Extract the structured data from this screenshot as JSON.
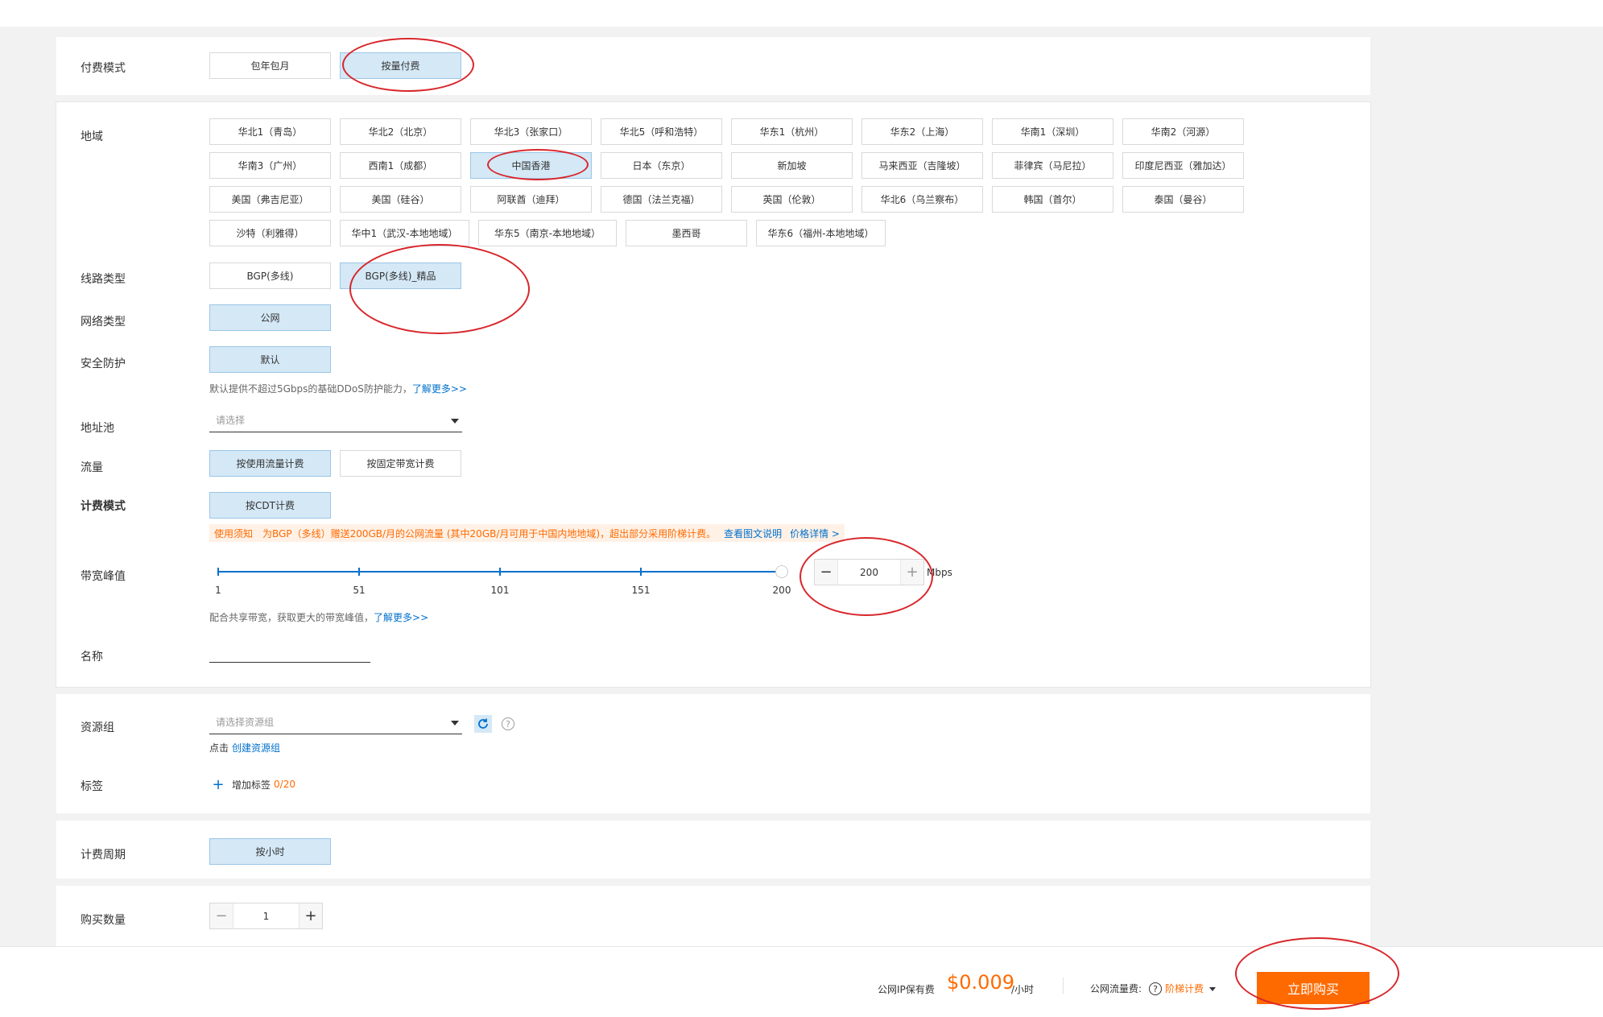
{
  "billing_mode": {
    "label": "付费模式",
    "options": [
      "包年包月",
      "按量付费"
    ],
    "selected": "按量付费"
  },
  "region": {
    "label": "地域",
    "options": [
      "华北1（青岛）",
      "华北2（北京）",
      "华北3（张家口）",
      "华北5（呼和浩特）",
      "华东1（杭州）",
      "华东2（上海）",
      "华南1（深圳）",
      "华南2（河源）",
      "华南3（广州）",
      "西南1（成都）",
      "中国香港",
      "日本（东京）",
      "新加坡",
      "马来西亚（吉隆坡）",
      "菲律宾（马尼拉）",
      "印度尼西亚（雅加达）",
      "美国（弗吉尼亚）",
      "美国（硅谷）",
      "阿联酋（迪拜）",
      "德国（法兰克福）",
      "英国（伦敦）",
      "华北6（乌兰察布）",
      "韩国（首尔）",
      "泰国（曼谷）",
      "沙特（利雅得）",
      "华中1（武汉-本地地域）",
      "华东5（南京-本地地域）",
      "墨西哥",
      "华东6（福州-本地地域）"
    ],
    "selected": "中国香港"
  },
  "line_type": {
    "label": "线路类型",
    "options": [
      "BGP(多线)",
      "BGP(多线)_精品"
    ],
    "selected": "BGP(多线)_精品"
  },
  "network_type": {
    "label": "网络类型",
    "options": [
      "公网"
    ],
    "selected": "公网"
  },
  "security": {
    "label": "安全防护",
    "options": [
      "默认"
    ],
    "selected": "默认",
    "hint": "默认提供不超过5Gbps的基础DDoS防护能力，",
    "hint_link": "了解更多>>"
  },
  "address_pool": {
    "label": "地址池",
    "placeholder": "请选择"
  },
  "traffic": {
    "label": "流量",
    "options": [
      "按使用流量计费",
      "按固定带宽计费"
    ],
    "selected": "按使用流量计费"
  },
  "billing_method": {
    "label": "计费模式",
    "options": [
      "按CDT计费"
    ],
    "selected": "按CDT计费",
    "notice_tag": "使用须知",
    "notice_text": "为BGP（多线）赠送200GB/月的公网流量 (其中20GB/月可用于中国内地地域)，超出部分采用阶梯计费。",
    "notice_link1": "查看图文说明",
    "notice_link2": "价格详情 >"
  },
  "bandwidth": {
    "label": "带宽峰值",
    "ticks": [
      "1",
      "51",
      "101",
      "151",
      "200"
    ],
    "min": 1,
    "max": 200,
    "value": 200,
    "value_text": "200",
    "unit": "Mbps",
    "minus": "−",
    "plus": "+",
    "hint": "配合共享带宽，获取更大的带宽峰值，",
    "hint_link": "了解更多>>"
  },
  "name": {
    "label": "名称"
  },
  "resource_group": {
    "label": "资源组",
    "placeholder": "请选择资源组",
    "hint": "点击",
    "hint_link": "创建资源组",
    "help": "?"
  },
  "tags": {
    "label": "标签",
    "add_icon": "+",
    "add_label": "增加标签",
    "count": "0/20"
  },
  "billing_period": {
    "label": "计费周期",
    "options": [
      "按小时"
    ],
    "selected": "按小时"
  },
  "quantity": {
    "label": "购买数量",
    "value": "1",
    "minus": "−",
    "plus": "+"
  },
  "footer": {
    "ip_fee_label": "公网IP保有费",
    "ip_fee_price": "$0.009",
    "ip_fee_unit": "/小时",
    "traffic_fee_label": "公网流量费:",
    "traffic_fee_help": "?",
    "traffic_fee_link": "阶梯计费",
    "buy_button": "立即购买"
  },
  "colors": {
    "accent_orange": "#ff6a00",
    "link_blue": "#0070cc",
    "selected_bg": "#d4e8f6",
    "annotation_red": "#d8262b"
  }
}
